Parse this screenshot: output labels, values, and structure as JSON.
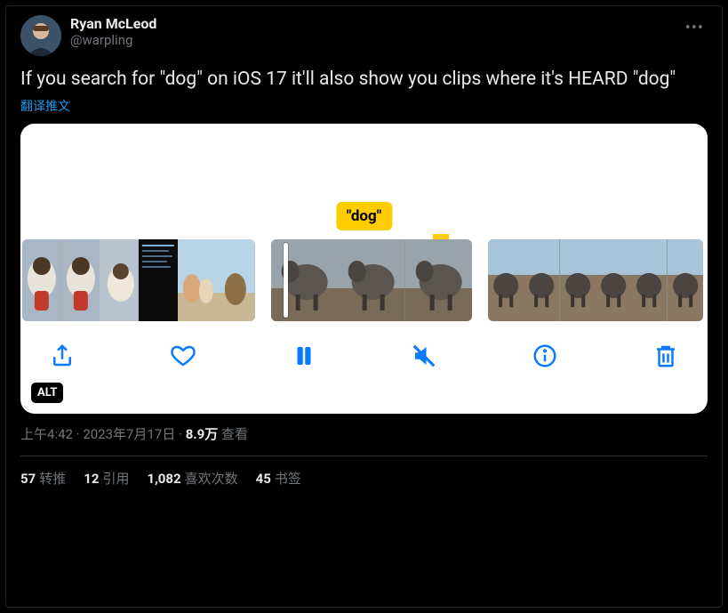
{
  "author": {
    "display_name": "Ryan McLeod",
    "handle": "@warpling"
  },
  "tweet_text": "If you search for \"dog\" on iOS 17 it'll also show you clips where it's HEARD \"dog\"",
  "translate_label": "翻译推文",
  "media": {
    "badge_text": "\"dog\"",
    "alt_label": "ALT",
    "controls": {
      "share": "share",
      "like": "like",
      "pause": "pause",
      "mute": "mute",
      "info": "info",
      "trash": "trash"
    }
  },
  "meta": {
    "time": "上午4:42",
    "sep1": " · ",
    "date": "2023年7月17日",
    "sep2": " · ",
    "views_num": "8.9万",
    "views_label": " 查看"
  },
  "stats": {
    "retweets_num": "57",
    "retweets_label": "转推",
    "quotes_num": "12",
    "quotes_label": "引用",
    "likes_num": "1,082",
    "likes_label": "喜欢次数",
    "bookmarks_num": "45",
    "bookmarks_label": "书签"
  }
}
